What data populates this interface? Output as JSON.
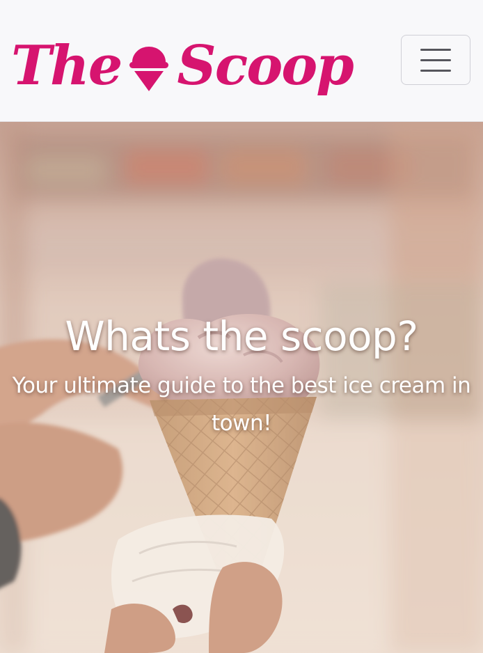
{
  "navbar": {
    "brand": {
      "word_left": "The",
      "word_right": "Scoop",
      "icon": "ice-cream-scoop-icon",
      "color": "#d6146f"
    },
    "toggler_icon": "hamburger-menu-icon"
  },
  "hero": {
    "title": "Whats the scoop?",
    "subtitle": "Your ultimate guide to the best ice cream in town!",
    "image": "ice-cream-cone-photo"
  },
  "colors": {
    "brand": "#d6146f",
    "navbar_bg": "#f8f8fa",
    "hero_text": "#ffffff"
  }
}
